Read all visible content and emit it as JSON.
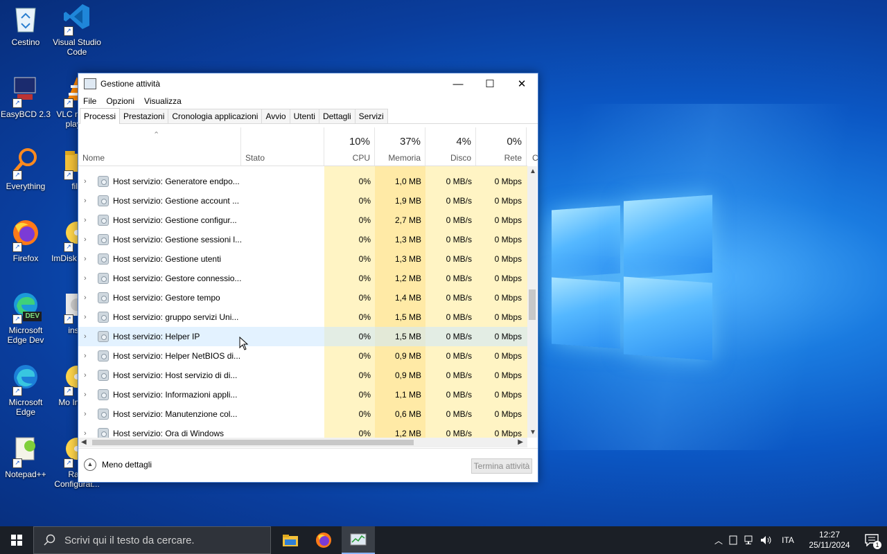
{
  "desktop": {
    "icons": [
      {
        "label": "Cestino",
        "icon": "recycle-bin-icon"
      },
      {
        "label": "Visual Studio Code",
        "icon": "vscode-icon"
      },
      {
        "label": "EasyBCD 2.3",
        "icon": "easybcd-icon"
      },
      {
        "label": "VLC media player",
        "icon": "vlc-icon"
      },
      {
        "label": "Everything",
        "icon": "everything-search-icon"
      },
      {
        "label": "file",
        "icon": "folder-icon"
      },
      {
        "label": "Firefox",
        "icon": "firefox-icon"
      },
      {
        "label": "ImDisk Virtual",
        "icon": "imdisk-icon"
      },
      {
        "label": "Microsoft Edge Dev",
        "icon": "edge-dev-icon",
        "badge": "DEV"
      },
      {
        "label": "insta",
        "icon": "installer-icon"
      },
      {
        "label": "Microsoft Edge",
        "icon": "edge-icon"
      },
      {
        "label": "Mo Image",
        "icon": "mount-image-icon"
      },
      {
        "label": "Notepad++",
        "icon": "notepadpp-icon"
      },
      {
        "label": "Ram Configurat...",
        "icon": "ramdisk-icon"
      }
    ]
  },
  "window": {
    "title": "Gestione attività",
    "controls": {
      "minimize": "—",
      "maximize": "☐",
      "close": "✕"
    },
    "menu": [
      "File",
      "Opzioni",
      "Visualizza"
    ],
    "tabs": [
      "Processi",
      "Prestazioni",
      "Cronologia applicazioni",
      "Avvio",
      "Utenti",
      "Dettagli",
      "Servizi"
    ],
    "active_tab": "Processi",
    "header": {
      "name": "Nome",
      "status": "Stato",
      "cpu": {
        "pct": "10%",
        "label": "CPU"
      },
      "memory": {
        "pct": "37%",
        "label": "Memoria"
      },
      "disk": {
        "pct": "4%",
        "label": "Disco"
      },
      "network": {
        "pct": "0%",
        "label": "Rete"
      },
      "more": "C"
    },
    "rows": [
      {
        "name": "Host servizio: Generatore endpo...",
        "cpu": "0%",
        "mem": "1,0 MB",
        "disk": "0 MB/s",
        "net": "0 Mbps"
      },
      {
        "name": "Host servizio: Gestione account ...",
        "cpu": "0%",
        "mem": "1,9 MB",
        "disk": "0 MB/s",
        "net": "0 Mbps"
      },
      {
        "name": "Host servizio: Gestione configur...",
        "cpu": "0%",
        "mem": "2,7 MB",
        "disk": "0 MB/s",
        "net": "0 Mbps"
      },
      {
        "name": "Host servizio: Gestione sessioni l...",
        "cpu": "0%",
        "mem": "1,3 MB",
        "disk": "0 MB/s",
        "net": "0 Mbps"
      },
      {
        "name": "Host servizio: Gestione utenti",
        "cpu": "0%",
        "mem": "1,3 MB",
        "disk": "0 MB/s",
        "net": "0 Mbps"
      },
      {
        "name": "Host servizio: Gestore connessio...",
        "cpu": "0%",
        "mem": "1,2 MB",
        "disk": "0 MB/s",
        "net": "0 Mbps"
      },
      {
        "name": "Host servizio: Gestore tempo",
        "cpu": "0%",
        "mem": "1,4 MB",
        "disk": "0 MB/s",
        "net": "0 Mbps"
      },
      {
        "name": "Host servizio: gruppo servizi Uni...",
        "cpu": "0%",
        "mem": "1,5 MB",
        "disk": "0 MB/s",
        "net": "0 Mbps"
      },
      {
        "name": "Host servizio: Helper IP",
        "cpu": "0%",
        "mem": "1,5 MB",
        "disk": "0 MB/s",
        "net": "0 Mbps",
        "highlight": true
      },
      {
        "name": "Host servizio: Helper NetBIOS di...",
        "cpu": "0%",
        "mem": "0,9 MB",
        "disk": "0 MB/s",
        "net": "0 Mbps"
      },
      {
        "name": "Host servizio: Host servizio di di...",
        "cpu": "0%",
        "mem": "0,9 MB",
        "disk": "0 MB/s",
        "net": "0 Mbps"
      },
      {
        "name": "Host servizio: Informazioni appli...",
        "cpu": "0%",
        "mem": "1,1 MB",
        "disk": "0 MB/s",
        "net": "0 Mbps"
      },
      {
        "name": "Host servizio: Manutenzione col...",
        "cpu": "0%",
        "mem": "0,6 MB",
        "disk": "0 MB/s",
        "net": "0 Mbps"
      },
      {
        "name": "Host servizio: Ora di Windows",
        "cpu": "0%",
        "mem": "1,2 MB",
        "disk": "0 MB/s",
        "net": "0 Mbps"
      }
    ],
    "footer": {
      "fewer_details": "Meno dettagli",
      "end_task": "Termina attività"
    }
  },
  "taskbar": {
    "search_placeholder": "Scrivi qui il testo da cercare.",
    "apps": [
      "file-explorer-icon",
      "firefox-icon",
      "task-manager-icon"
    ],
    "language": "ITA",
    "time": "12:27",
    "date": "25/11/2024",
    "notification_count": "1"
  },
  "colors": {
    "accent": "#0078d7",
    "cpu_col": "#fff4c4",
    "mem_col": "#ffeaa6"
  }
}
